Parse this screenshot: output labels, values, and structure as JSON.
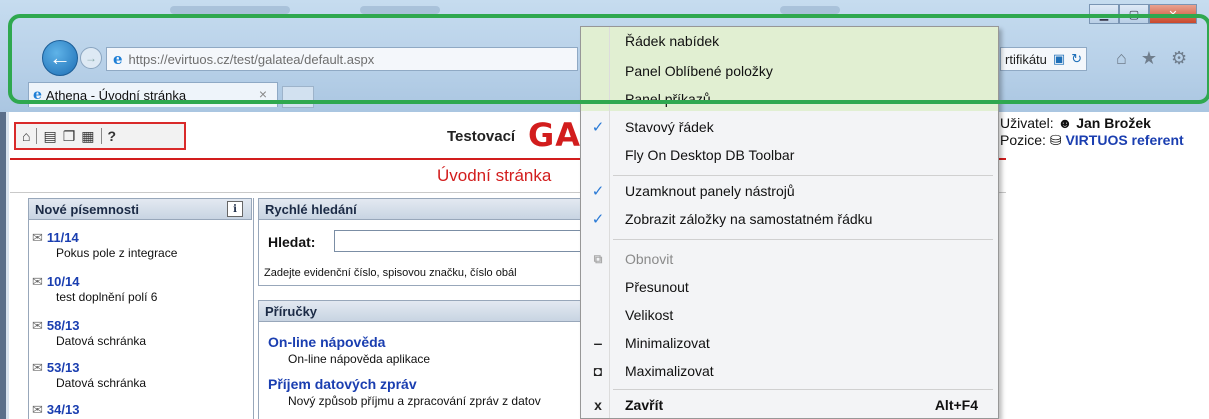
{
  "browser": {
    "url_prefix": "https://evirtuos.cz",
    "url_path": "/test/galatea/default.aspx",
    "cert_text": "rtifikátu",
    "tab_title": "Athena - Úvodní stránka",
    "tab_close": "×"
  },
  "app": {
    "toolbar_help": "?",
    "testovaci": "Testovací",
    "logo_red": "GA",
    "logo_black": "",
    "page_title": "Úvodní stránka",
    "user_label": "Uživatel:",
    "user_name": "Jan Brožek",
    "position_label": "Pozice:",
    "position_value": "VIRTUOS referent"
  },
  "new_docs": {
    "title": "Nové písemnosti",
    "info": "i",
    "items": [
      {
        "num": "11/14",
        "desc": "Pokus pole z integrace"
      },
      {
        "num": "10/14",
        "desc": "test doplnění polí 6"
      },
      {
        "num": "58/13",
        "desc": "Datová schránka"
      },
      {
        "num": "53/13",
        "desc": "Datová schránka"
      },
      {
        "num": "34/13",
        "desc": ""
      }
    ]
  },
  "quick_search": {
    "title": "Rychlé hledání",
    "label": "Hledat:",
    "value": "",
    "hint": "Zadejte evidenční číslo, spisovou značku, číslo obál"
  },
  "manuals": {
    "title": "Příručky",
    "items": [
      {
        "title": "On-line nápověda",
        "desc": "On-line nápověda aplikace"
      },
      {
        "title": "Příjem datových zpráv",
        "desc": "Nový způsob příjmu a zpracování zpráv z datov"
      }
    ]
  },
  "context_menu": {
    "items": [
      {
        "label": "Řádek nabídek"
      },
      {
        "label": "Panel Oblíbené položky"
      },
      {
        "label": "Panel příkazů"
      },
      {
        "label": "Stavový řádek",
        "check": "✓"
      },
      {
        "label": "Fly On Desktop DB Toolbar"
      },
      {
        "label": "Uzamknout panely nástrojů",
        "check": "✓"
      },
      {
        "label": "Zobrazit záložky na samostatném řádku",
        "check": "✓"
      },
      {
        "label": "Obnovit"
      },
      {
        "label": "Přesunout"
      },
      {
        "label": "Velikost"
      },
      {
        "label": "Minimalizovat"
      },
      {
        "label": "Maximalizovat"
      },
      {
        "label": "Zavřít",
        "shortcut": "Alt+F4",
        "icon": "x"
      }
    ]
  },
  "colors": {
    "highlight": "#2fa84f",
    "accent_red": "#d21d1d",
    "link_blue": "#1a3eb0"
  }
}
